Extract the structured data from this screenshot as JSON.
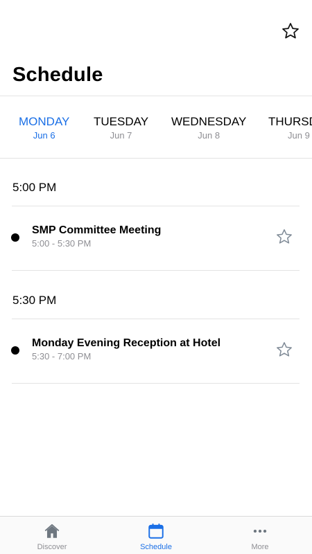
{
  "header": {
    "title": "Schedule",
    "favorite_icon": "star-outline-icon"
  },
  "days": [
    {
      "name": "MONDAY",
      "date": "Jun 6",
      "selected": true
    },
    {
      "name": "TUESDAY",
      "date": "Jun 7",
      "selected": false
    },
    {
      "name": "WEDNESDAY",
      "date": "Jun 8",
      "selected": false
    },
    {
      "name": "THURSDAY",
      "date": "Jun 9",
      "selected": false
    }
  ],
  "schedule": [
    {
      "time": "5:00 PM",
      "event": {
        "title": "SMP Committee Meeting",
        "time_range": "5:00 - 5:30 PM",
        "favorited": false
      }
    },
    {
      "time": "5:30 PM",
      "event": {
        "title": "Monday Evening Reception at Hotel",
        "time_range": "5:30 - 7:00 PM",
        "favorited": false
      }
    }
  ],
  "tabbar": {
    "items": [
      {
        "label": "Discover",
        "icon": "home-icon",
        "active": false
      },
      {
        "label": "Schedule",
        "icon": "calendar-icon",
        "active": true
      },
      {
        "label": "More",
        "icon": "more-dots-icon",
        "active": false
      }
    ]
  },
  "colors": {
    "accent": "#1a6fe6",
    "muted": "#8e8e93",
    "divider": "#e3e3e3"
  }
}
